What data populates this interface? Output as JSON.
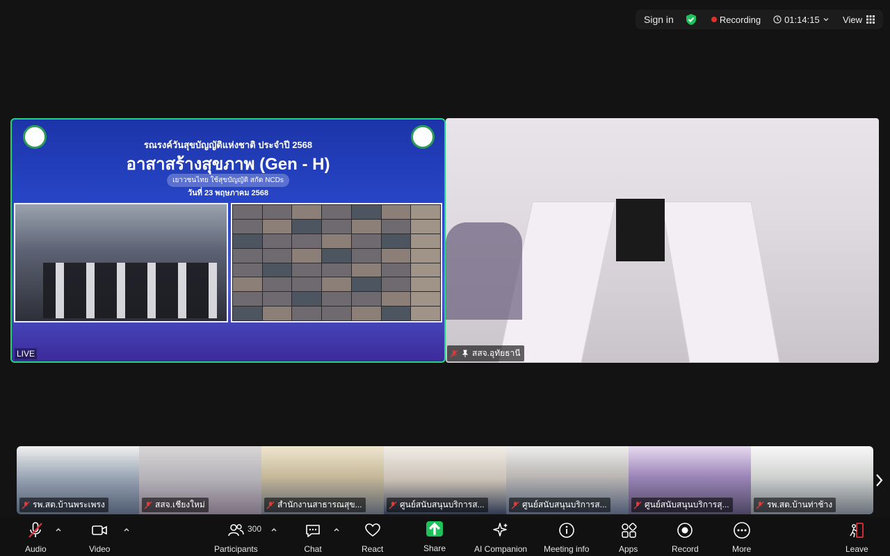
{
  "topbar": {
    "sign_in": "Sign in",
    "recording": "Recording",
    "timer": "01:14:15",
    "view": "View"
  },
  "main_left": {
    "banner_title": "รณรงค์วันสุขบัญญัติแห่งชาติ ประจำปี 2568",
    "banner_main": "อาสาสร้างสุขภาพ (Gen - H)",
    "banner_sub": "เยาวชนไทย ใช้สุขบัญญัติ สกัด NCDs",
    "banner_date": "วันที่ 23 พฤษภาคม 2568",
    "live_label": "LIVE"
  },
  "main_right": {
    "participant_name": "สสจ.อุทัยธานี"
  },
  "thumbnails": [
    {
      "name": "รพ.สต.บ้านพระเพรง"
    },
    {
      "name": "สสจ.เชียงใหม่"
    },
    {
      "name": "สำนักงานสาธารณสุข..."
    },
    {
      "name": "ศูนย์สนับสนุนบริการส..."
    },
    {
      "name": "ศูนย์สนับสนุนบริการส..."
    },
    {
      "name": "ศูนย์สนับสนุนบริการสุ..."
    },
    {
      "name": "รพ.สต.บ้านท่าช้าง"
    }
  ],
  "toolbar": {
    "audio": "Audio",
    "video": "Video",
    "participants": "Participants",
    "participants_count": "300",
    "chat": "Chat",
    "react": "React",
    "share": "Share",
    "ai_companion": "AI Companion",
    "meeting_info": "Meeting info",
    "apps": "Apps",
    "record": "Record",
    "more": "More",
    "leave": "Leave"
  },
  "colors": {
    "active_speaker_border": "#22d37f",
    "share_green": "#1fc15d",
    "record_red": "#e02f2f",
    "leave_red": "#e0303a"
  }
}
